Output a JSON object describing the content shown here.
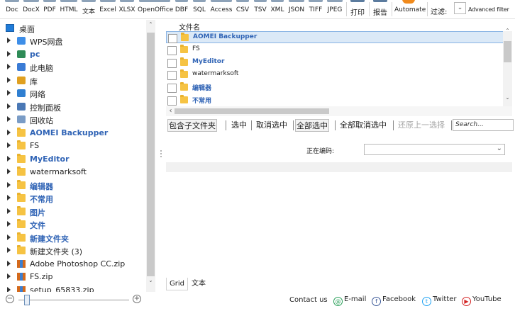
{
  "toolbar": {
    "formats": [
      "Doc",
      "DocX",
      "PDF",
      "HTML",
      "文本",
      "Excel",
      "XLSX",
      "OpenOffice",
      "DBF",
      "SQL",
      "Access",
      "CSV",
      "TSV",
      "XML",
      "JSON",
      "TIFF",
      "JPEG"
    ],
    "print_label": "打印",
    "report_label": "报告",
    "automate_label": "Automate",
    "filter_label": "过滤:",
    "advanced_filter_label": "Advanced filter"
  },
  "tree": {
    "root": "桌面",
    "items": [
      {
        "label": "WPS网盘",
        "icon": "cloud-icon",
        "style": "normal"
      },
      {
        "label": "pc",
        "icon": "user-icon",
        "style": "blue"
      },
      {
        "label": "此电脑",
        "icon": "computer-icon",
        "style": "normal"
      },
      {
        "label": "库",
        "icon": "library-icon",
        "style": "normal"
      },
      {
        "label": "网络",
        "icon": "network-icon",
        "style": "normal"
      },
      {
        "label": "控制面板",
        "icon": "control-panel-icon",
        "style": "normal"
      },
      {
        "label": "回收站",
        "icon": "recycle-bin-icon",
        "style": "normal"
      },
      {
        "label": "AOMEI Backupper",
        "icon": "folder-icon",
        "style": "blue"
      },
      {
        "label": "FS",
        "icon": "folder-icon",
        "style": "normal"
      },
      {
        "label": "MyEditor",
        "icon": "folder-icon",
        "style": "blue"
      },
      {
        "label": "watermarksoft",
        "icon": "folder-icon",
        "style": "normal"
      },
      {
        "label": "编辑器",
        "icon": "folder-icon",
        "style": "blue"
      },
      {
        "label": "不常用",
        "icon": "folder-icon",
        "style": "blue"
      },
      {
        "label": "图片",
        "icon": "folder-icon",
        "style": "blue"
      },
      {
        "label": "文件",
        "icon": "folder-icon",
        "style": "blue"
      },
      {
        "label": "新建文件夹",
        "icon": "folder-icon",
        "style": "blue"
      },
      {
        "label": "新建文件夹 (3)",
        "icon": "folder-icon",
        "style": "normal"
      },
      {
        "label": "Adobe Photoshop CC.zip",
        "icon": "zip-icon",
        "style": "normal"
      },
      {
        "label": "FS.zip",
        "icon": "zip-icon",
        "style": "normal"
      },
      {
        "label": "setup_65833.zip",
        "icon": "zip-icon",
        "style": "normal"
      }
    ]
  },
  "file_list": {
    "column_header": "文件名",
    "rows": [
      {
        "name": "AOMEI Backupper",
        "style": "blue",
        "selected": true
      },
      {
        "name": "FS",
        "style": "normal",
        "selected": false
      },
      {
        "name": "MyEditor",
        "style": "blue",
        "selected": false
      },
      {
        "name": "watermarksoft",
        "style": "normal",
        "selected": false
      },
      {
        "name": "编辑器",
        "style": "blue",
        "selected": false
      },
      {
        "name": "不常用",
        "style": "blue",
        "selected": false
      }
    ]
  },
  "actions": {
    "include_subfolders": "包含子文件夹",
    "select": "选中",
    "deselect": "取消选中",
    "select_all": "全部选中",
    "deselect_all": "全部取消选中",
    "restore_previous": "还原上一选择",
    "search_placeholder": "Search..."
  },
  "encoding": {
    "label": "正在编码:",
    "value": ""
  },
  "tabs": [
    "Grid",
    "文本"
  ],
  "footer": {
    "contact": "Contact us",
    "email": "E-mail",
    "facebook": "Facebook",
    "twitter": "Twitter",
    "youtube": "YouTube"
  },
  "colors": {
    "accent_blue": "#2f63b5",
    "folder_yellow": "#f6c343",
    "selection_bg": "#dbe9f7",
    "automate_orange": "#f08a1c"
  }
}
